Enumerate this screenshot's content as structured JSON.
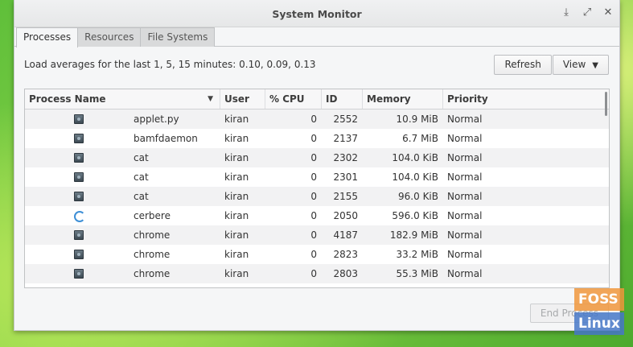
{
  "window": {
    "title": "System Monitor"
  },
  "tabs": [
    {
      "label": "Processes",
      "active": true
    },
    {
      "label": "Resources",
      "active": false
    },
    {
      "label": "File Systems",
      "active": false
    }
  ],
  "load_averages": "Load averages for the last 1, 5, 15 minutes: 0.10, 0.09, 0.13",
  "toolbar": {
    "refresh_label": "Refresh",
    "view_label": "View"
  },
  "table": {
    "columns": [
      "Process Name",
      "User",
      "% CPU",
      "ID",
      "Memory",
      "Priority"
    ],
    "rows": [
      {
        "name": "applet.py",
        "user": "kiran",
        "cpu": "0",
        "id": "2552",
        "memory": "10.9 MiB",
        "priority": "Normal",
        "icon": "process-icon"
      },
      {
        "name": "bamfdaemon",
        "user": "kiran",
        "cpu": "0",
        "id": "2137",
        "memory": "6.7 MiB",
        "priority": "Normal",
        "icon": "process-icon"
      },
      {
        "name": "cat",
        "user": "kiran",
        "cpu": "0",
        "id": "2302",
        "memory": "104.0 KiB",
        "priority": "Normal",
        "icon": "process-icon"
      },
      {
        "name": "cat",
        "user": "kiran",
        "cpu": "0",
        "id": "2301",
        "memory": "104.0 KiB",
        "priority": "Normal",
        "icon": "process-icon"
      },
      {
        "name": "cat",
        "user": "kiran",
        "cpu": "0",
        "id": "2155",
        "memory": "96.0 KiB",
        "priority": "Normal",
        "icon": "process-icon"
      },
      {
        "name": "cerbere",
        "user": "kiran",
        "cpu": "0",
        "id": "2050",
        "memory": "596.0 KiB",
        "priority": "Normal",
        "icon": "cerbere-icon"
      },
      {
        "name": "chrome",
        "user": "kiran",
        "cpu": "0",
        "id": "4187",
        "memory": "182.9 MiB",
        "priority": "Normal",
        "icon": "process-icon"
      },
      {
        "name": "chrome",
        "user": "kiran",
        "cpu": "0",
        "id": "2823",
        "memory": "33.2 MiB",
        "priority": "Normal",
        "icon": "process-icon"
      },
      {
        "name": "chrome",
        "user": "kiran",
        "cpu": "0",
        "id": "2803",
        "memory": "55.3 MiB",
        "priority": "Normal",
        "icon": "process-icon"
      }
    ]
  },
  "end_process_label": "End Process",
  "watermark": {
    "line1": "FOSS",
    "line2": "Linux"
  }
}
